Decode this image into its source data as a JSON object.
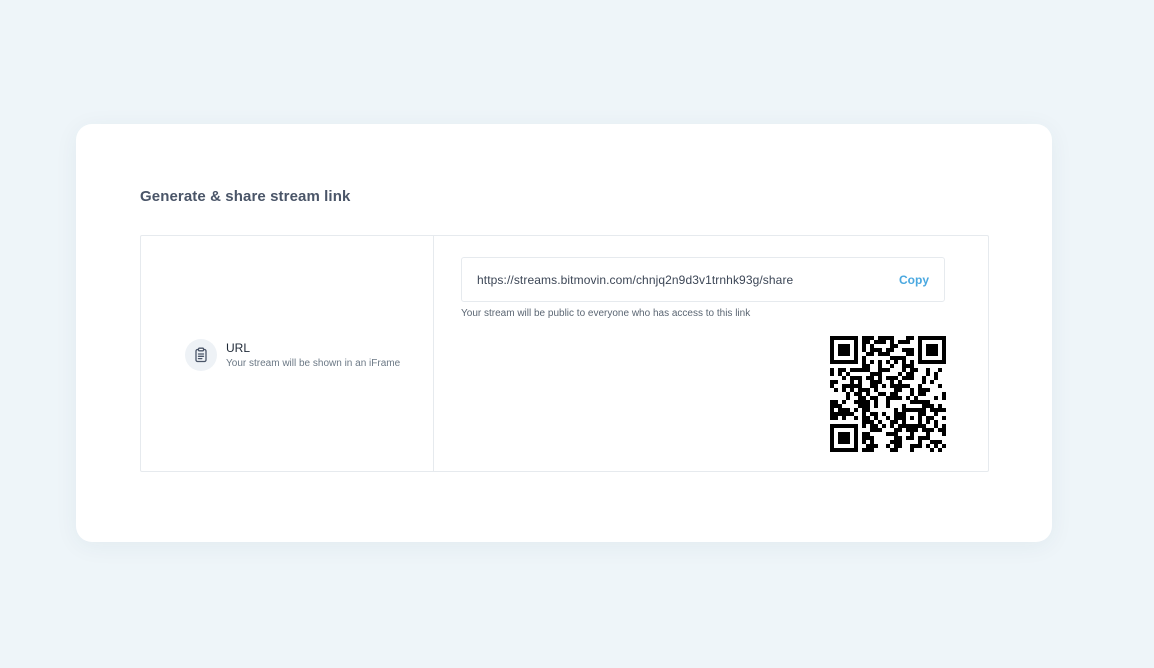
{
  "card": {
    "title": "Generate & share stream link"
  },
  "option": {
    "icon": "clipboard-icon",
    "title": "URL",
    "description": "Your stream will be shown in an iFrame"
  },
  "share": {
    "url": "https://streams.bitmovin.com/chnjq2n9d3v1trnhk93g/share",
    "copy_label": "Copy",
    "hint": "Your stream will be public to everyone who has access to this link"
  },
  "colors": {
    "background": "#eef5f9",
    "accent": "#4aa8e0",
    "border": "#e6eaee"
  }
}
